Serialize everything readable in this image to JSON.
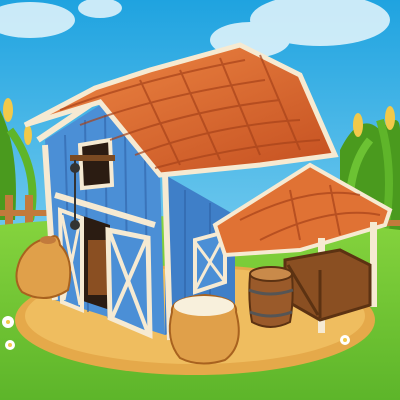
{
  "scene": {
    "subject": "barn-farm-icon",
    "colors": {
      "sky_top": "#1fa3e0",
      "sky_bottom": "#8fd8f5",
      "grass": "#6cc233",
      "grass_dark": "#4a9a1e",
      "dirt": "#e5a94a",
      "barn_wall": "#4b8fd6",
      "barn_wall_dark": "#2f63a8",
      "roof": "#d9602a",
      "roof_light": "#f08a46",
      "trim": "#f6ead2",
      "wood": "#9a5a2a",
      "sack": "#e0a04a"
    },
    "icons": [
      "barn-icon",
      "roof-icon",
      "sack-icon",
      "barrel-icon",
      "crate-icon",
      "corn-icon",
      "cloud-icon",
      "pulley-icon",
      "fence-icon",
      "flower-icon"
    ]
  }
}
